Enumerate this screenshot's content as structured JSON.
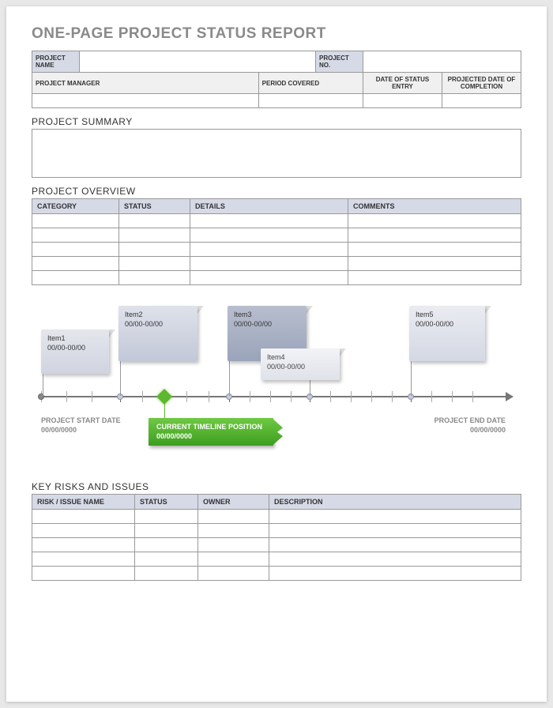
{
  "title": "ONE-PAGE PROJECT STATUS REPORT",
  "header": {
    "project_name_label": "PROJECT NAME",
    "project_name": "",
    "project_no_label": "PROJECT NO.",
    "project_no": "",
    "project_manager_label": "PROJECT MANAGER",
    "project_manager": "",
    "period_covered_label": "PERIOD COVERED",
    "period_covered": "",
    "date_status_label": "DATE OF STATUS ENTRY",
    "date_status": "",
    "projected_completion_label": "PROJECTED DATE OF COMPLETION",
    "projected_completion": ""
  },
  "summary": {
    "title": "PROJECT SUMMARY",
    "body": ""
  },
  "overview": {
    "title": "PROJECT OVERVIEW",
    "columns": {
      "c1": "CATEGORY",
      "c2": "STATUS",
      "c3": "DETAILS",
      "c4": "COMMENTS"
    }
  },
  "timeline": {
    "start_label": "PROJECT START DATE",
    "start_date": "00/00/0000",
    "end_label": "PROJECT END DATE",
    "end_date": "00/00/0000",
    "current_label": "CURRENT TIMELINE POSITION",
    "current_date": "00/00/0000",
    "items": {
      "i1": {
        "title": "Item1",
        "date": "00/00-00/00"
      },
      "i2": {
        "title": "Item2",
        "date": "00/00-00/00"
      },
      "i3": {
        "title": "Item3",
        "date": "00/00-00/00"
      },
      "i4": {
        "title": "Item4",
        "date": "00/00-00/00"
      },
      "i5": {
        "title": "Item5",
        "date": "00/00-00/00"
      }
    }
  },
  "risks": {
    "title": "KEY RISKS AND ISSUES",
    "columns": {
      "c1": "RISK / ISSUE NAME",
      "c2": "STATUS",
      "c3": "OWNER",
      "c4": "DESCRIPTION"
    }
  }
}
